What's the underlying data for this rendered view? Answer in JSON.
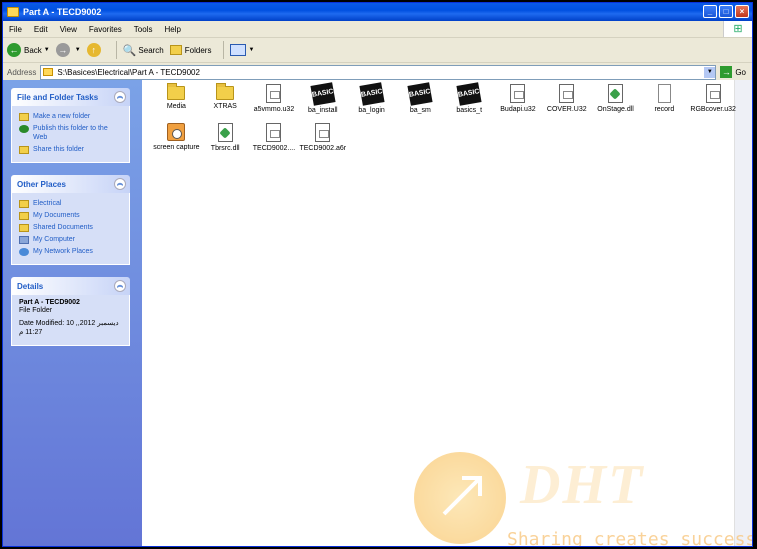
{
  "window": {
    "title": "Part A - TECD9002"
  },
  "menu": [
    "File",
    "Edit",
    "View",
    "Favorites",
    "Tools",
    "Help"
  ],
  "toolbar": {
    "back": "Back",
    "search": "Search",
    "folders": "Folders"
  },
  "address": {
    "label": "Address",
    "path": "S:\\Basices\\Electrical\\Part A - TECD9002",
    "go": "Go"
  },
  "tasks": {
    "file_folder": {
      "title": "File and Folder Tasks",
      "links": [
        "Make a new folder",
        "Publish this folder to the Web",
        "Share this folder"
      ]
    },
    "other_places": {
      "title": "Other Places",
      "links": [
        "Electrical",
        "My Documents",
        "Shared Documents",
        "My Computer",
        "My Network Places"
      ]
    },
    "details": {
      "title": "Details",
      "name": "Part A - TECD9002",
      "type": "File Folder",
      "modified": "Date Modified: 10 ,ديسمبر 2012, 11:27 م"
    }
  },
  "files": [
    {
      "name": "Media",
      "icon": "folder"
    },
    {
      "name": "XTRAS",
      "icon": "folder"
    },
    {
      "name": "a5vmmo.u32",
      "icon": "doc"
    },
    {
      "name": "ba_install",
      "icon": "basics"
    },
    {
      "name": "ba_login",
      "icon": "basics"
    },
    {
      "name": "ba_sm",
      "icon": "basics"
    },
    {
      "name": "basics_t",
      "icon": "basics"
    },
    {
      "name": "Budapi.u32",
      "icon": "doc"
    },
    {
      "name": "COVER.U32",
      "icon": "doc"
    },
    {
      "name": "OnStage.dll",
      "icon": "dll"
    },
    {
      "name": "record",
      "icon": "rec"
    },
    {
      "name": "RGBcover.u32",
      "icon": "doc"
    },
    {
      "name": "screen capture",
      "icon": "cap"
    },
    {
      "name": "Tbrsrc.dll",
      "icon": "dll"
    },
    {
      "name": "TECD9002....",
      "icon": "doc"
    },
    {
      "name": "TECD9002.a6r",
      "icon": "doc"
    }
  ],
  "basics_text": "BASICS",
  "watermark": {
    "brand": "DHT",
    "tagline": "Sharing creates success"
  }
}
